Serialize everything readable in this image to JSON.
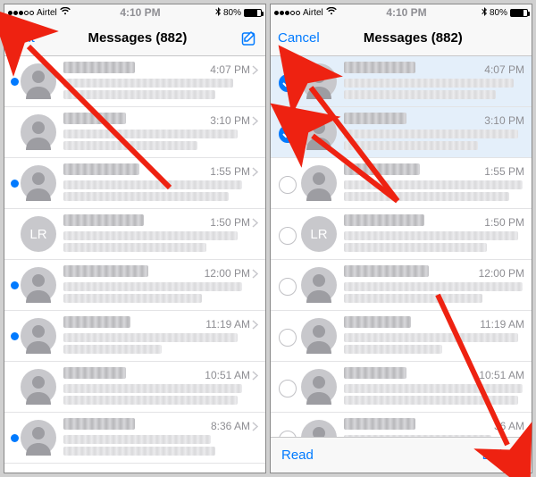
{
  "status": {
    "carrier": "Airtel",
    "time": "4:10 PM",
    "battery_pct": "80%"
  },
  "left": {
    "nav": {
      "left": "Edit",
      "title": "Messages (882)"
    },
    "rows": [
      {
        "time": "4:07 PM",
        "unread": true,
        "avatar": "silhouette",
        "initials": "",
        "name_w": 80,
        "p1": 190,
        "p2": 170
      },
      {
        "time": "3:10 PM",
        "unread": false,
        "avatar": "silhouette",
        "initials": "",
        "name_w": 70,
        "p1": 195,
        "p2": 150
      },
      {
        "time": "1:55 PM",
        "unread": true,
        "avatar": "silhouette",
        "initials": "",
        "name_w": 85,
        "p1": 200,
        "p2": 185
      },
      {
        "time": "1:50 PM",
        "unread": false,
        "avatar": "initials",
        "initials": "LR",
        "name_w": 90,
        "p1": 195,
        "p2": 160
      },
      {
        "time": "12:00 PM",
        "unread": true,
        "avatar": "silhouette",
        "initials": "",
        "name_w": 95,
        "p1": 200,
        "p2": 155
      },
      {
        "time": "11:19 AM",
        "unread": true,
        "avatar": "silhouette",
        "initials": "",
        "name_w": 75,
        "p1": 195,
        "p2": 110
      },
      {
        "time": "10:51 AM",
        "unread": false,
        "avatar": "silhouette",
        "initials": "",
        "name_w": 70,
        "p1": 200,
        "p2": 195
      },
      {
        "time": "8:36 AM",
        "unread": true,
        "avatar": "silhouette",
        "initials": "",
        "name_w": 80,
        "p1": 165,
        "p2": 170
      }
    ]
  },
  "right": {
    "nav": {
      "left": "Cancel",
      "title": "Messages (882)"
    },
    "toolbar": {
      "read": "Read",
      "delete": "Delete"
    },
    "rows": [
      {
        "time": "4:07 PM",
        "checked": true,
        "avatar": "silhouette",
        "initials": "",
        "name_w": 80,
        "p1": 190,
        "p2": 170
      },
      {
        "time": "3:10 PM",
        "checked": true,
        "avatar": "silhouette",
        "initials": "",
        "name_w": 70,
        "p1": 195,
        "p2": 150
      },
      {
        "time": "1:55 PM",
        "checked": false,
        "avatar": "silhouette",
        "initials": "",
        "name_w": 85,
        "p1": 200,
        "p2": 185
      },
      {
        "time": "1:50 PM",
        "checked": false,
        "avatar": "initials",
        "initials": "LR",
        "name_w": 90,
        "p1": 195,
        "p2": 160
      },
      {
        "time": "12:00 PM",
        "checked": false,
        "avatar": "silhouette",
        "initials": "",
        "name_w": 95,
        "p1": 200,
        "p2": 155
      },
      {
        "time": "11:19 AM",
        "checked": false,
        "avatar": "silhouette",
        "initials": "",
        "name_w": 75,
        "p1": 195,
        "p2": 110
      },
      {
        "time": "10:51 AM",
        "checked": false,
        "avatar": "silhouette",
        "initials": "",
        "name_w": 70,
        "p1": 200,
        "p2": 195
      },
      {
        "time": "36 AM",
        "checked": false,
        "avatar": "silhouette",
        "initials": "",
        "name_w": 80,
        "p1": 165,
        "p2": 170
      }
    ]
  }
}
